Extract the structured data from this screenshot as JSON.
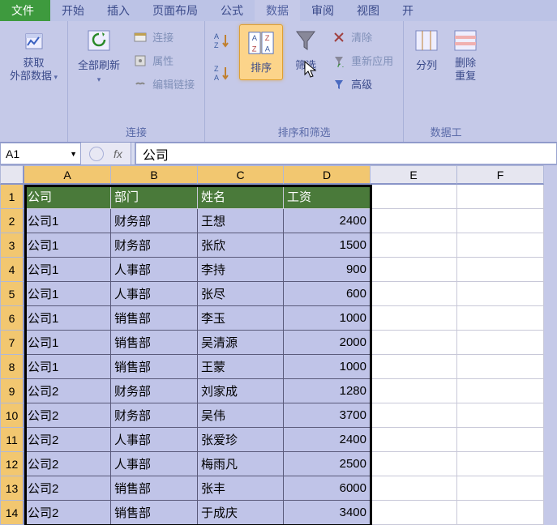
{
  "menu": {
    "file": "文件",
    "tabs": [
      "开始",
      "插入",
      "页面布局",
      "公式",
      "数据",
      "审阅",
      "视图",
      "开"
    ],
    "active_index": 4
  },
  "ribbon": {
    "groups": {
      "external": {
        "btn": "获取\n外部数据",
        "label": ""
      },
      "connections": {
        "refresh": "全部刷新",
        "conn": "连接",
        "props": "属性",
        "editlinks": "编辑链接",
        "label": "连接"
      },
      "sortfilter": {
        "sort": "排序",
        "filter": "筛选",
        "clear": "清除",
        "reapply": "重新应用",
        "advanced": "高级",
        "label": "排序和筛选"
      },
      "datatools": {
        "textcol": "分列",
        "dedup": "删除\n重复",
        "label": "数据工"
      }
    }
  },
  "namebox": "A1",
  "fx": "fx",
  "formula": "公司",
  "columns": [
    "A",
    "B",
    "C",
    "D",
    "E",
    "F"
  ],
  "selected_cols": 4,
  "rows": [
    1,
    2,
    3,
    4,
    5,
    6,
    7,
    8,
    9,
    10,
    11,
    12,
    13,
    14
  ],
  "selected_rows": 14,
  "headers": [
    "公司",
    "部门",
    "姓名",
    "工资"
  ],
  "data": [
    [
      "公司1",
      "财务部",
      "王想",
      "2400"
    ],
    [
      "公司1",
      "财务部",
      "张欣",
      "1500"
    ],
    [
      "公司1",
      "人事部",
      "李持",
      "900"
    ],
    [
      "公司1",
      "人事部",
      "张尽",
      "600"
    ],
    [
      "公司1",
      "销售部",
      "李玉",
      "1000"
    ],
    [
      "公司1",
      "销售部",
      "吴清源",
      "2000"
    ],
    [
      "公司1",
      "销售部",
      "王蒙",
      "1000"
    ],
    [
      "公司2",
      "财务部",
      "刘家成",
      "1280"
    ],
    [
      "公司2",
      "财务部",
      "吴伟",
      "3700"
    ],
    [
      "公司2",
      "人事部",
      "张爱珍",
      "2400"
    ],
    [
      "公司2",
      "人事部",
      "梅雨凡",
      "2500"
    ],
    [
      "公司2",
      "销售部",
      "张丰",
      "6000"
    ],
    [
      "公司2",
      "销售部",
      "于成庆",
      "3400"
    ]
  ]
}
